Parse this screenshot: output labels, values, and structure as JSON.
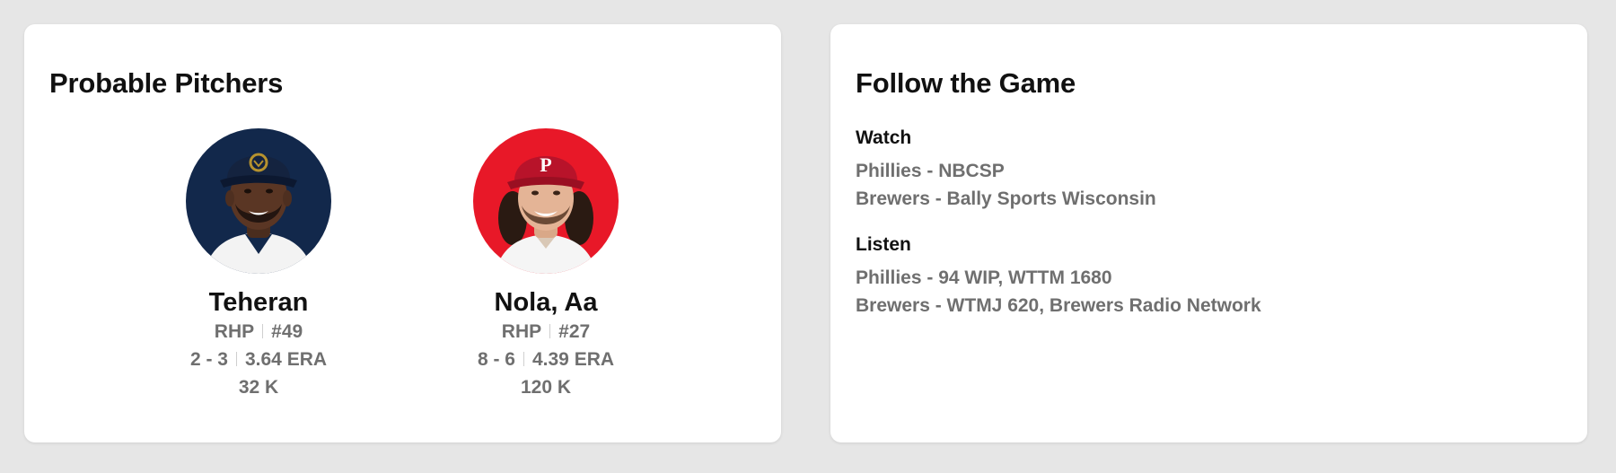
{
  "probable_pitchers": {
    "title": "Probable Pitchers",
    "pitchers": [
      {
        "name": "Teheran",
        "position": "RHP",
        "number": "#49",
        "record": "2 - 3",
        "era": "3.64 ERA",
        "strikeouts": "32 K",
        "avatar_bg": "#12284b",
        "team": "Brewers"
      },
      {
        "name": "Nola, Aa",
        "position": "RHP",
        "number": "#27",
        "record": "8 - 6",
        "era": "4.39 ERA",
        "strikeouts": "120 K",
        "avatar_bg": "#e81828",
        "team": "Phillies"
      }
    ]
  },
  "follow_game": {
    "title": "Follow the Game",
    "watch": {
      "heading": "Watch",
      "items": [
        "Phillies - NBCSP",
        "Brewers - Bally Sports Wisconsin"
      ]
    },
    "listen": {
      "heading": "Listen",
      "items": [
        "Phillies - 94 WIP, WTTM 1680",
        "Brewers - WTMJ 620, Brewers Radio Network"
      ]
    }
  },
  "colors": {
    "page_bg": "#e6e6e6",
    "card_bg": "#ffffff",
    "text_primary": "#111111",
    "text_secondary": "#6f6f6f"
  }
}
